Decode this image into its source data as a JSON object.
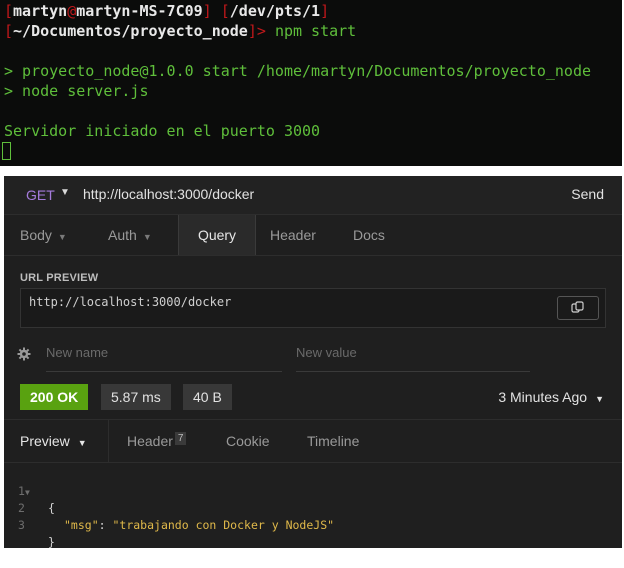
{
  "terminal": {
    "prompt_user": "martyn",
    "prompt_at": "@",
    "prompt_host": "martyn-MS-7C09",
    "prompt_tty": "/dev/pts/1",
    "prompt_cwd": "~/Documentos/proyecto_node",
    "prompt_arrow": "> ",
    "command": "npm start",
    "output_1": "> proyecto_node@1.0.0 start /home/martyn/Documentos/proyecto_node",
    "output_2": "> node server.js",
    "output_3": "Servidor iniciado en el puerto 3000"
  },
  "request": {
    "method": "GET",
    "url": "http://localhost:3000/docker",
    "send_label": "Send"
  },
  "request_tabs": [
    "Body",
    "Auth",
    "Query",
    "Header",
    "Docs"
  ],
  "url_preview": {
    "label": "URL PREVIEW",
    "value": "http://localhost:3000/docker"
  },
  "query_params": {
    "name_placeholder": "New name",
    "value_placeholder": "New value"
  },
  "response": {
    "status": "200 OK",
    "time": "5.87 ms",
    "size": "40 B",
    "time_ago": "3 Minutes Ago"
  },
  "response_tabs": {
    "preview": "Preview",
    "header": "Header",
    "header_count": "7",
    "cookie": "Cookie",
    "timeline": "Timeline"
  },
  "code_lines": [
    {
      "num": "1",
      "open": "{"
    },
    {
      "num": "2",
      "key": "\"msg\"",
      "sep": ": ",
      "value": "\"trabajando con Docker y NodeJS\""
    },
    {
      "num": "3",
      "close": "}"
    }
  ],
  "colors": {
    "method": "#a57bdc",
    "status_ok": "#59a210",
    "terminal_green": "#5fbf3b",
    "terminal_red": "#c0181b"
  }
}
